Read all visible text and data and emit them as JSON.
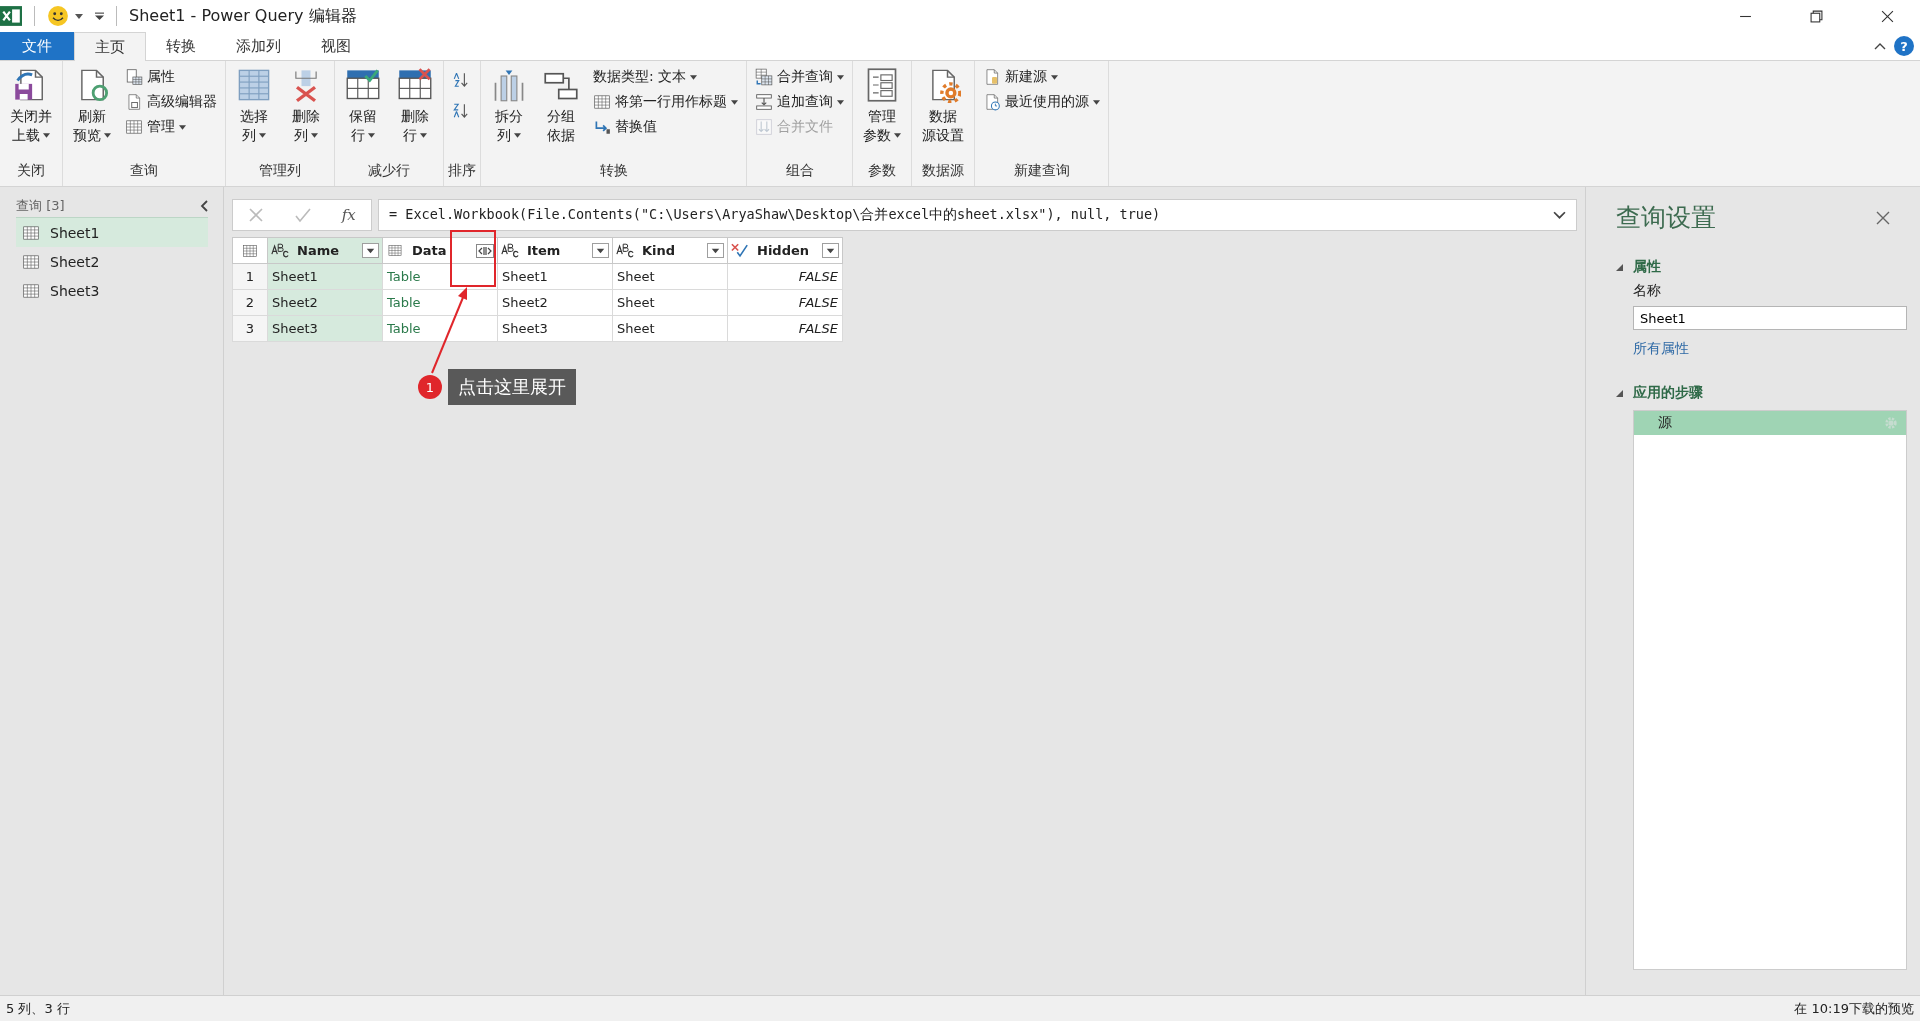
{
  "window": {
    "title": "Sheet1 - Power Query 编辑器",
    "help": "?"
  },
  "tabs": [
    {
      "label": "文件",
      "kind": "file",
      "selected": false
    },
    {
      "label": "主页",
      "kind": "tab",
      "selected": true
    },
    {
      "label": "转换",
      "kind": "tab",
      "selected": false
    },
    {
      "label": "添加列",
      "kind": "tab",
      "selected": false
    },
    {
      "label": "视图",
      "kind": "tab",
      "selected": false
    }
  ],
  "ribbon": {
    "groups": [
      {
        "label": "关闭",
        "items": [
          {
            "kind": "large",
            "lines": [
              "关闭并",
              "上载"
            ],
            "menu": true,
            "disabled": false
          }
        ]
      },
      {
        "label": "查询",
        "items": [
          {
            "kind": "large",
            "lines": [
              "刷新",
              "预览"
            ],
            "menu": true,
            "disabled": false
          },
          {
            "kind": "small",
            "lines": [
              "属性"
            ],
            "menu": false,
            "disabled": false
          },
          {
            "kind": "small",
            "lines": [
              "高级编辑器"
            ],
            "menu": false,
            "disabled": false
          },
          {
            "kind": "small",
            "lines": [
              "管理"
            ],
            "menu": true,
            "disabled": false
          }
        ]
      },
      {
        "label": "管理列",
        "items": [
          {
            "kind": "large",
            "lines": [
              "选择",
              "列"
            ],
            "menu": true,
            "disabled": false
          },
          {
            "kind": "large",
            "lines": [
              "删除",
              "列"
            ],
            "menu": true,
            "disabled": false
          }
        ]
      },
      {
        "label": "减少行",
        "items": [
          {
            "kind": "large",
            "lines": [
              "保留",
              "行"
            ],
            "menu": true,
            "disabled": false
          },
          {
            "kind": "large",
            "lines": [
              "删除",
              "行"
            ],
            "menu": true,
            "disabled": false
          }
        ]
      },
      {
        "label": "排序",
        "items": [
          {
            "kind": "icon",
            "disabled": false
          },
          {
            "kind": "icon",
            "disabled": false
          }
        ]
      },
      {
        "label": "转换",
        "items": [
          {
            "kind": "large",
            "lines": [
              "拆分",
              "列"
            ],
            "menu": true,
            "disabled": false
          },
          {
            "kind": "large",
            "lines": [
              "分组",
              "依据"
            ],
            "menu": false,
            "disabled": false
          },
          {
            "kind": "small",
            "lines": [
              "数据类型: 文本"
            ],
            "menu": true,
            "disabled": false
          },
          {
            "kind": "small",
            "lines": [
              "将第一行用作标题"
            ],
            "menu": true,
            "disabled": false
          },
          {
            "kind": "small",
            "lines": [
              "替换值"
            ],
            "menu": false,
            "disabled": false
          }
        ]
      },
      {
        "label": "组合",
        "items": [
          {
            "kind": "small",
            "lines": [
              "合并查询"
            ],
            "menu": true,
            "disabled": false
          },
          {
            "kind": "small",
            "lines": [
              "追加查询"
            ],
            "menu": true,
            "disabled": false
          },
          {
            "kind": "small",
            "lines": [
              "合并文件"
            ],
            "menu": false,
            "disabled": true
          }
        ]
      },
      {
        "label": "参数",
        "items": [
          {
            "kind": "large",
            "lines": [
              "管理",
              "参数"
            ],
            "menu": true,
            "disabled": false
          }
        ]
      },
      {
        "label": "数据源",
        "items": [
          {
            "kind": "large",
            "lines": [
              "数据",
              "源设置"
            ],
            "menu": false,
            "disabled": false
          }
        ]
      },
      {
        "label": "新建查询",
        "items": [
          {
            "kind": "small",
            "lines": [
              "新建源"
            ],
            "menu": true,
            "disabled": false
          },
          {
            "kind": "small",
            "lines": [
              "最近使用的源"
            ],
            "menu": true,
            "disabled": false
          }
        ]
      }
    ]
  },
  "queries": {
    "header": "查询 [3]",
    "items": [
      {
        "label": "Sheet1",
        "selected": true
      },
      {
        "label": "Sheet2",
        "selected": false
      },
      {
        "label": "Sheet3",
        "selected": false
      }
    ]
  },
  "formula_bar": {
    "fx": "fx",
    "formula": "= Excel.Workbook(File.Contents(\"C:\\Users\\AryaShaw\\Desktop\\合并excel中的sheet.xlsx\"), null, true)"
  },
  "table": {
    "columns": [
      {
        "name": "Name",
        "kind": "text",
        "selected": true
      },
      {
        "name": "Data",
        "kind": "table",
        "selected": false
      },
      {
        "name": "Item",
        "kind": "text",
        "selected": false
      },
      {
        "name": "Kind",
        "kind": "text",
        "selected": false
      },
      {
        "name": "Hidden",
        "kind": "logical",
        "selected": false
      }
    ],
    "rows": [
      {
        "number": "1",
        "cells": [
          "Sheet1",
          "Table",
          "Sheet1",
          "Sheet",
          "FALSE"
        ]
      },
      {
        "number": "2",
        "cells": [
          "Sheet2",
          "Table",
          "Sheet2",
          "Sheet",
          "FALSE"
        ]
      },
      {
        "number": "3",
        "cells": [
          "Sheet3",
          "Table",
          "Sheet3",
          "Sheet",
          "FALSE"
        ]
      }
    ]
  },
  "annotation": {
    "badge": "1",
    "text": "点击这里展开"
  },
  "settings": {
    "title": "查询设置",
    "properties_heading": "属性",
    "name_label": "名称",
    "name_value": "Sheet1",
    "all_properties": "所有属性",
    "steps_heading": "应用的步骤",
    "steps": [
      {
        "label": "源",
        "selected": true
      }
    ]
  },
  "status_bar": {
    "left": "5 列、3 行",
    "right": "在 10:19下载的预览"
  }
}
